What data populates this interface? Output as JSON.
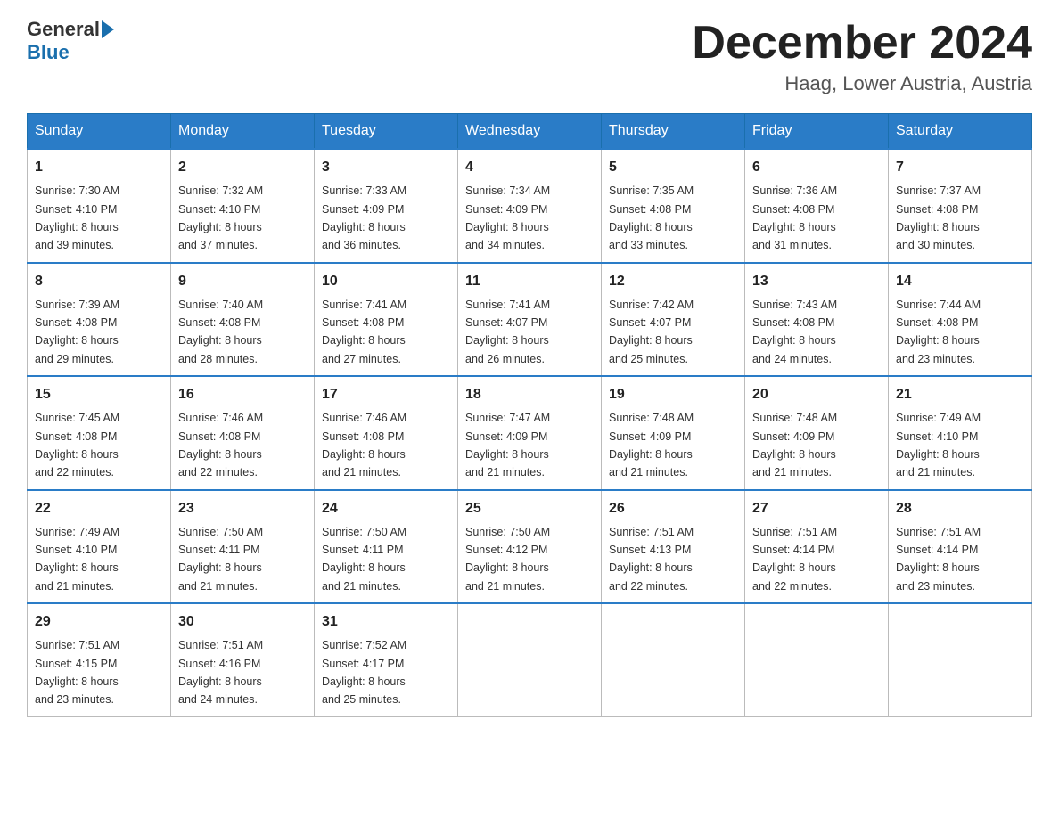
{
  "header": {
    "logo_general": "General",
    "logo_blue": "Blue",
    "month": "December 2024",
    "location": "Haag, Lower Austria, Austria"
  },
  "days_of_week": [
    "Sunday",
    "Monday",
    "Tuesday",
    "Wednesday",
    "Thursday",
    "Friday",
    "Saturday"
  ],
  "weeks": [
    [
      {
        "day": "1",
        "sunrise": "7:30 AM",
        "sunset": "4:10 PM",
        "daylight": "8 hours and 39 minutes."
      },
      {
        "day": "2",
        "sunrise": "7:32 AM",
        "sunset": "4:10 PM",
        "daylight": "8 hours and 37 minutes."
      },
      {
        "day": "3",
        "sunrise": "7:33 AM",
        "sunset": "4:09 PM",
        "daylight": "8 hours and 36 minutes."
      },
      {
        "day": "4",
        "sunrise": "7:34 AM",
        "sunset": "4:09 PM",
        "daylight": "8 hours and 34 minutes."
      },
      {
        "day": "5",
        "sunrise": "7:35 AM",
        "sunset": "4:08 PM",
        "daylight": "8 hours and 33 minutes."
      },
      {
        "day": "6",
        "sunrise": "7:36 AM",
        "sunset": "4:08 PM",
        "daylight": "8 hours and 31 minutes."
      },
      {
        "day": "7",
        "sunrise": "7:37 AM",
        "sunset": "4:08 PM",
        "daylight": "8 hours and 30 minutes."
      }
    ],
    [
      {
        "day": "8",
        "sunrise": "7:39 AM",
        "sunset": "4:08 PM",
        "daylight": "8 hours and 29 minutes."
      },
      {
        "day": "9",
        "sunrise": "7:40 AM",
        "sunset": "4:08 PM",
        "daylight": "8 hours and 28 minutes."
      },
      {
        "day": "10",
        "sunrise": "7:41 AM",
        "sunset": "4:08 PM",
        "daylight": "8 hours and 27 minutes."
      },
      {
        "day": "11",
        "sunrise": "7:41 AM",
        "sunset": "4:07 PM",
        "daylight": "8 hours and 26 minutes."
      },
      {
        "day": "12",
        "sunrise": "7:42 AM",
        "sunset": "4:07 PM",
        "daylight": "8 hours and 25 minutes."
      },
      {
        "day": "13",
        "sunrise": "7:43 AM",
        "sunset": "4:08 PM",
        "daylight": "8 hours and 24 minutes."
      },
      {
        "day": "14",
        "sunrise": "7:44 AM",
        "sunset": "4:08 PM",
        "daylight": "8 hours and 23 minutes."
      }
    ],
    [
      {
        "day": "15",
        "sunrise": "7:45 AM",
        "sunset": "4:08 PM",
        "daylight": "8 hours and 22 minutes."
      },
      {
        "day": "16",
        "sunrise": "7:46 AM",
        "sunset": "4:08 PM",
        "daylight": "8 hours and 22 minutes."
      },
      {
        "day": "17",
        "sunrise": "7:46 AM",
        "sunset": "4:08 PM",
        "daylight": "8 hours and 21 minutes."
      },
      {
        "day": "18",
        "sunrise": "7:47 AM",
        "sunset": "4:09 PM",
        "daylight": "8 hours and 21 minutes."
      },
      {
        "day": "19",
        "sunrise": "7:48 AM",
        "sunset": "4:09 PM",
        "daylight": "8 hours and 21 minutes."
      },
      {
        "day": "20",
        "sunrise": "7:48 AM",
        "sunset": "4:09 PM",
        "daylight": "8 hours and 21 minutes."
      },
      {
        "day": "21",
        "sunrise": "7:49 AM",
        "sunset": "4:10 PM",
        "daylight": "8 hours and 21 minutes."
      }
    ],
    [
      {
        "day": "22",
        "sunrise": "7:49 AM",
        "sunset": "4:10 PM",
        "daylight": "8 hours and 21 minutes."
      },
      {
        "day": "23",
        "sunrise": "7:50 AM",
        "sunset": "4:11 PM",
        "daylight": "8 hours and 21 minutes."
      },
      {
        "day": "24",
        "sunrise": "7:50 AM",
        "sunset": "4:11 PM",
        "daylight": "8 hours and 21 minutes."
      },
      {
        "day": "25",
        "sunrise": "7:50 AM",
        "sunset": "4:12 PM",
        "daylight": "8 hours and 21 minutes."
      },
      {
        "day": "26",
        "sunrise": "7:51 AM",
        "sunset": "4:13 PM",
        "daylight": "8 hours and 22 minutes."
      },
      {
        "day": "27",
        "sunrise": "7:51 AM",
        "sunset": "4:14 PM",
        "daylight": "8 hours and 22 minutes."
      },
      {
        "day": "28",
        "sunrise": "7:51 AM",
        "sunset": "4:14 PM",
        "daylight": "8 hours and 23 minutes."
      }
    ],
    [
      {
        "day": "29",
        "sunrise": "7:51 AM",
        "sunset": "4:15 PM",
        "daylight": "8 hours and 23 minutes."
      },
      {
        "day": "30",
        "sunrise": "7:51 AM",
        "sunset": "4:16 PM",
        "daylight": "8 hours and 24 minutes."
      },
      {
        "day": "31",
        "sunrise": "7:52 AM",
        "sunset": "4:17 PM",
        "daylight": "8 hours and 25 minutes."
      },
      null,
      null,
      null,
      null
    ]
  ],
  "labels": {
    "sunrise": "Sunrise:",
    "sunset": "Sunset:",
    "daylight": "Daylight:"
  }
}
